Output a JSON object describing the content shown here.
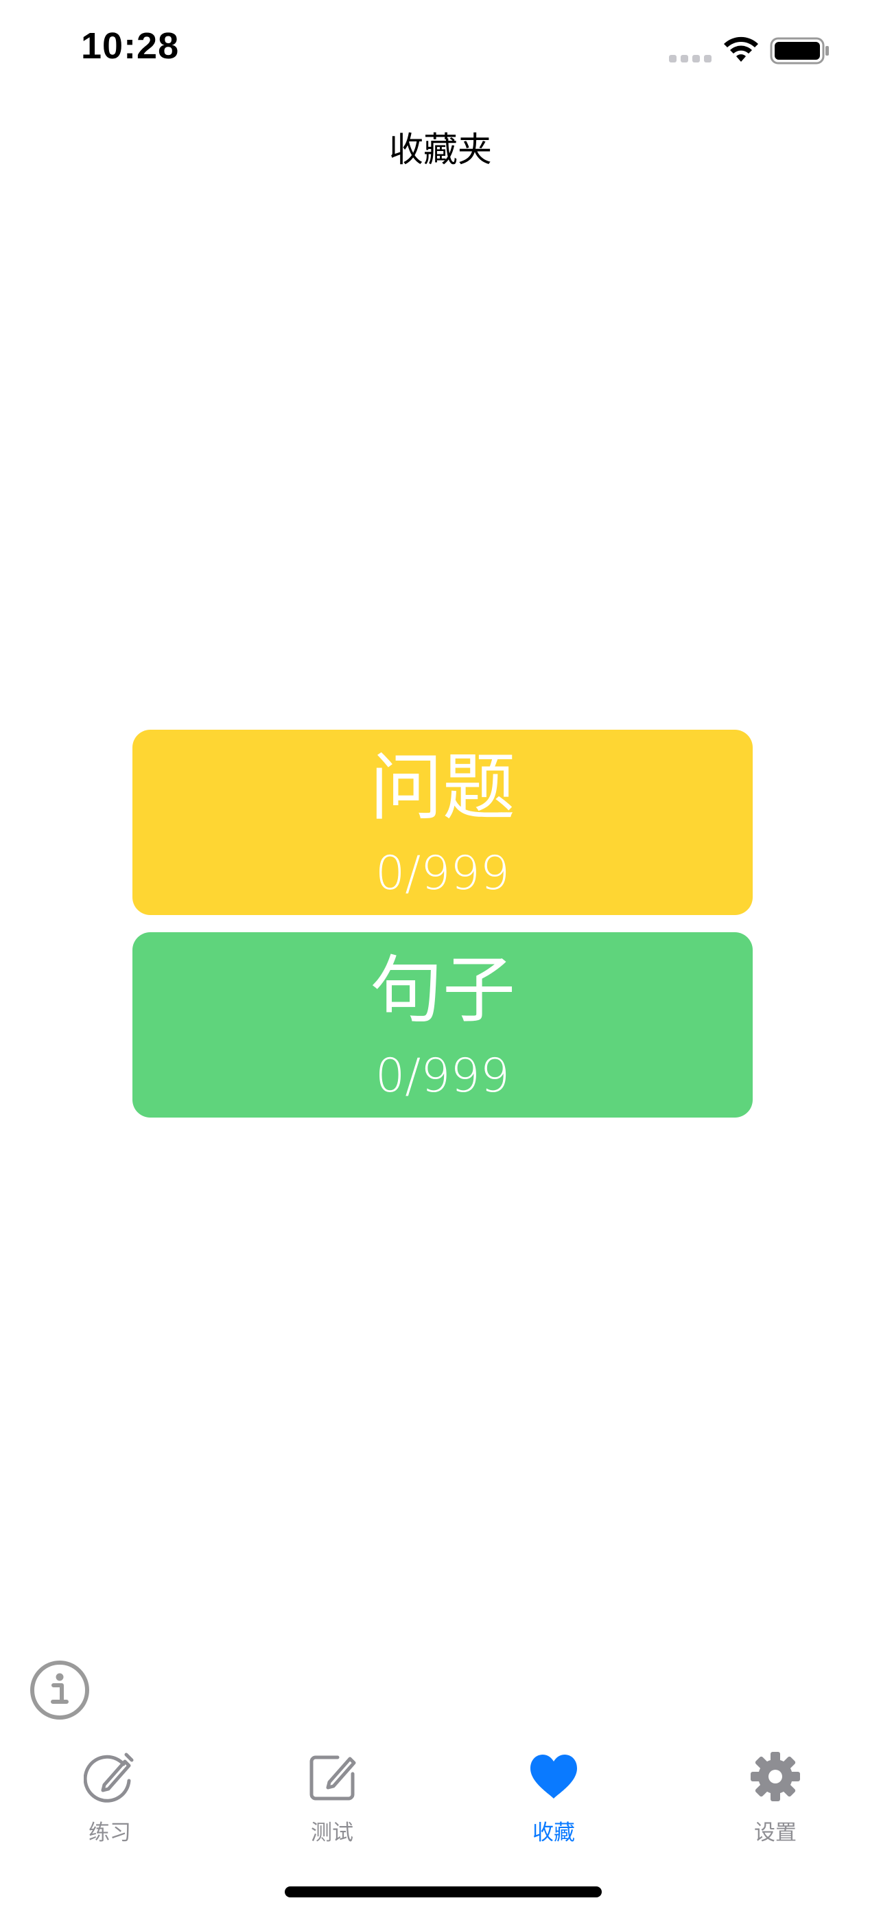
{
  "status_bar": {
    "time": "10:28"
  },
  "nav": {
    "title": "收藏夹"
  },
  "cards": [
    {
      "title": "问题",
      "count": "0/999",
      "color": "#fed633"
    },
    {
      "title": "句子",
      "count": "0/999",
      "color": "#5fd47c"
    }
  ],
  "info_button": {
    "icon": "info-icon"
  },
  "tabs": [
    {
      "label": "练习",
      "icon": "pencil-circle-icon",
      "active": false
    },
    {
      "label": "测试",
      "icon": "square-pencil-icon",
      "active": false
    },
    {
      "label": "收藏",
      "icon": "heart-icon",
      "active": true
    },
    {
      "label": "设置",
      "icon": "gear-icon",
      "active": false
    }
  ],
  "colors": {
    "accent": "#0a7aff",
    "inactive": "#8e8e93"
  }
}
